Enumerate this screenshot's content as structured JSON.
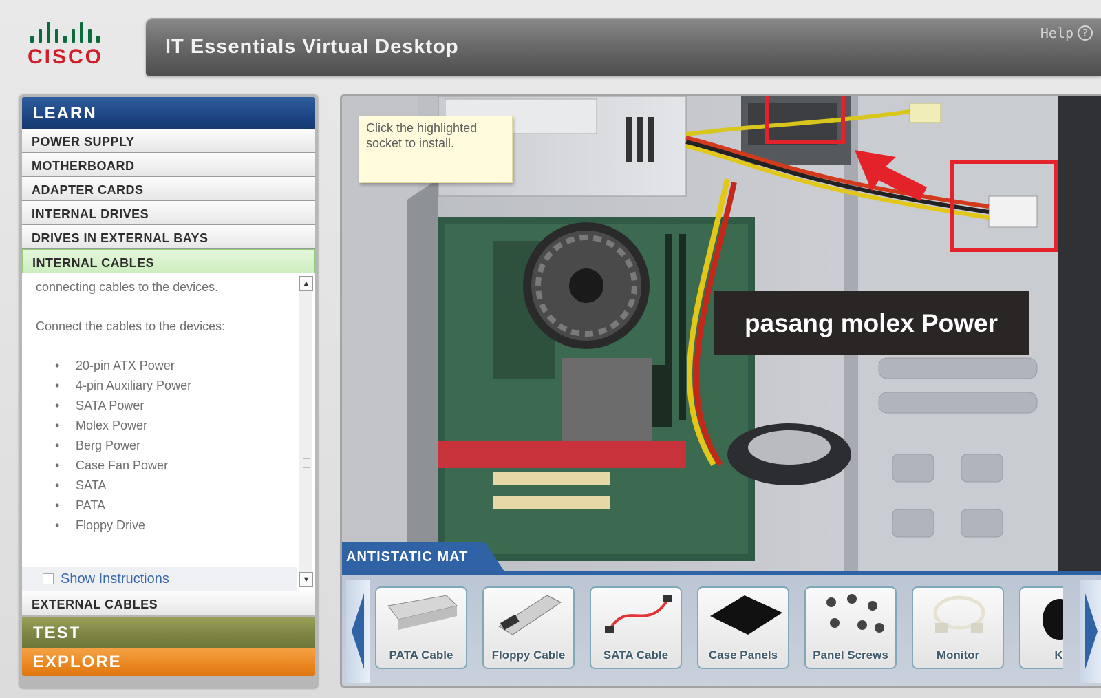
{
  "header": {
    "logo_text": "CISCO",
    "title": "IT Essentials Virtual Desktop",
    "help_label": "Help",
    "help_icon": "question-circle-icon"
  },
  "sidebar": {
    "learn_label": "LEARN",
    "items": [
      {
        "label": "POWER SUPPLY"
      },
      {
        "label": "MOTHERBOARD"
      },
      {
        "label": "ADAPTER CARDS"
      },
      {
        "label": "INTERNAL DRIVES"
      },
      {
        "label": "DRIVES IN EXTERNAL BAYS"
      },
      {
        "label": "INTERNAL CABLES",
        "active": true
      }
    ],
    "content": {
      "line1": "connecting cables to the devices.",
      "line2": "Connect the cables to the devices:",
      "bullets": [
        "20-pin ATX Power",
        "4-pin Auxiliary Power",
        "SATA Power",
        "Molex Power",
        "Berg Power",
        "Case Fan Power",
        "SATA",
        "PATA",
        "Floppy Drive"
      ]
    },
    "show_instructions": "Show Instructions",
    "external_cables": "EXTERNAL CABLES",
    "test_label": "TEST",
    "explore_label": "EXPLORE"
  },
  "main": {
    "tooltip": "Click the highlighted socket to install.",
    "overlay": "pasang molex Power",
    "mat_label": "ANTISTATIC MAT",
    "highlight_color": "#e3222a"
  },
  "tray": {
    "items": [
      {
        "label": "PATA Cable",
        "icon": "pata-cable-icon"
      },
      {
        "label": "Floppy Cable",
        "icon": "floppy-cable-icon"
      },
      {
        "label": "SATA Cable",
        "icon": "sata-cable-icon"
      },
      {
        "label": "Case Panels",
        "icon": "case-panel-icon"
      },
      {
        "label": "Panel Screws",
        "icon": "screws-icon"
      },
      {
        "label": "Monitor",
        "icon": "monitor-cable-icon"
      },
      {
        "label": "Key",
        "icon": "keyboard-icon"
      }
    ]
  }
}
